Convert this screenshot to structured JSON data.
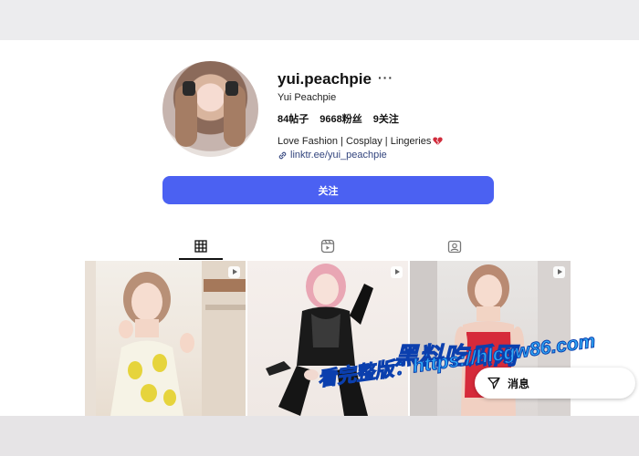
{
  "profile": {
    "username": "yui.peachpie",
    "more_label": "···",
    "full_name": "Yui Peachpie",
    "stats": {
      "posts": "84帖子",
      "followers": "9668粉丝",
      "following": "9关注"
    },
    "bio": "Love Fashion | Cosplay | Lingeries",
    "link": "linktr.ee/yui_peachpie",
    "follow_label": "关注"
  },
  "tabs": [
    {
      "icon": "grid-icon",
      "active": true
    },
    {
      "icon": "reels-icon",
      "active": false
    },
    {
      "icon": "tagged-icon",
      "active": false
    }
  ],
  "message_button": {
    "label": "消息"
  },
  "watermark": {
    "title": "黑料吃瓜网",
    "url": "看完整版：https://hlcgw86.com"
  },
  "colors": {
    "accent": "#4b61f2",
    "link": "#33457e",
    "watermark": "#2ea7f5"
  }
}
